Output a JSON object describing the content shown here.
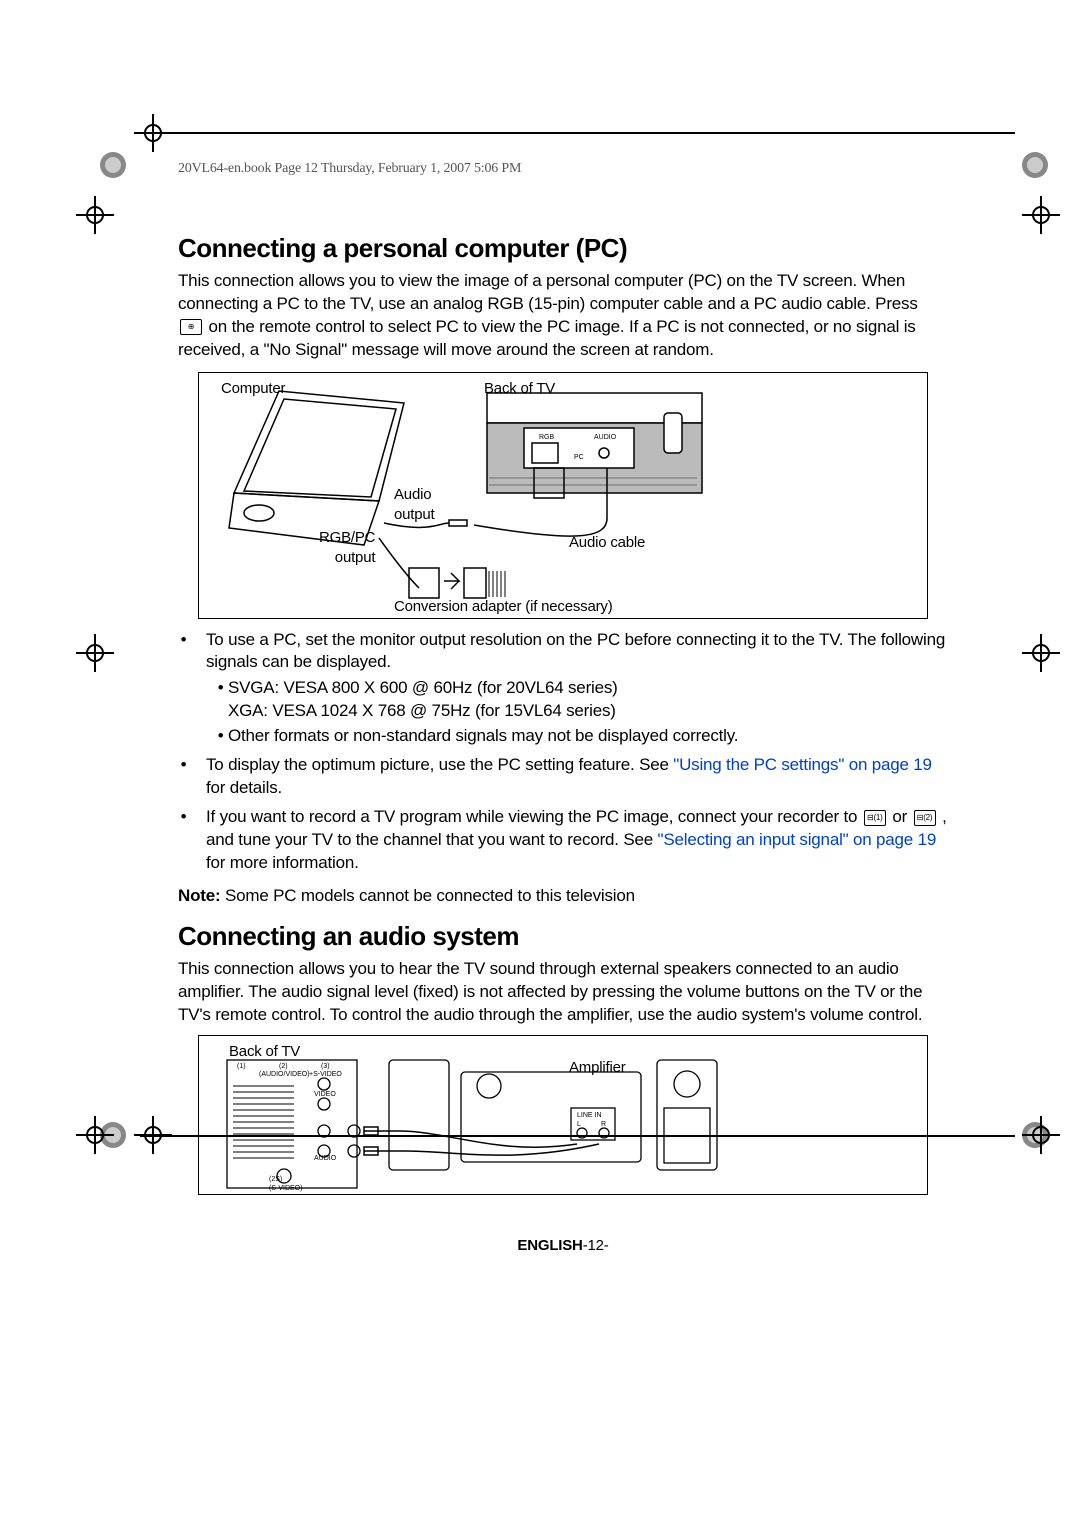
{
  "header": "20VL64-en.book  Page 12  Thursday, February 1, 2007  5:06 PM",
  "sec1": {
    "title": "Connecting a personal computer (PC)",
    "para1a": "This connection allows you to view the image of a personal computer (PC) on the TV screen. When connecting a PC to the TV, use an analog RGB (15-pin) computer cable and a PC audio cable. Press ",
    "para1b": " on the remote control to select PC to view the PC image. If a PC is not connected, or no signal is received, a \"No Signal\" message will move around the screen at random.",
    "fig": {
      "computer": "Computer",
      "back": "Back of TV",
      "rgb": "RGB",
      "audio": "AUDIO",
      "pc": "PC",
      "audiooutput": "Audio\noutput",
      "rgbpcoutput": "RGB/PC\noutput",
      "audiocable": "Audio cable",
      "conversion": "Conversion adapter (if necessary)"
    },
    "bul1": "To use a PC, set the monitor output resolution on the PC before connecting it to the TV. The following signals can be displayed.",
    "bul1a": "SVGA: VESA 800 X 600 @ 60Hz (for 20VL64 series)\nXGA: VESA 1024 X 768 @ 75Hz (for 15VL64 series)",
    "bul1b": "Other formats or non-standard signals may not be displayed correctly.",
    "bul2a": "To display the optimum picture, use the PC setting feature. See ",
    "bul2link": "\"Using the PC settings\" on page 19",
    "bul2b": " for details.",
    "bul3a": "If you want to record a TV program while viewing the PC image, connect your recorder to ",
    "bul3b": " or ",
    "bul3c": " , and tune your TV to the channel that you want to record. See ",
    "bul3link": "\"Selecting an input signal\" on page 19",
    "bul3d": " for more information.",
    "notelabel": "Note:",
    "note": " Some PC models cannot be connected to this television"
  },
  "sec2": {
    "title": "Connecting an audio system",
    "para": "This connection allows you to hear the TV sound through external speakers connected to an audio amplifier. The audio signal level (fixed) is not affected by pressing the volume buttons on the TV or the TV's remote control. To control the audio through the amplifier, use the audio system's volume control.",
    "fig": {
      "back": "Back of TV",
      "amp": "Amplifier",
      "linein": "LINE IN",
      "l": "L",
      "r": "R",
      "p1": "(1)",
      "p2": "(2)",
      "p3": "(3)",
      "av": "(AUDIO/VIDEO)",
      "svideo": "+S-VIDEO",
      "video": "VIDEO",
      "audio2": "AUDIO",
      "sv2": "(S-VIDEO)",
      "out2s": "(2S)"
    }
  },
  "footer": {
    "lang": "ENGLISH",
    "page": "-12-"
  }
}
